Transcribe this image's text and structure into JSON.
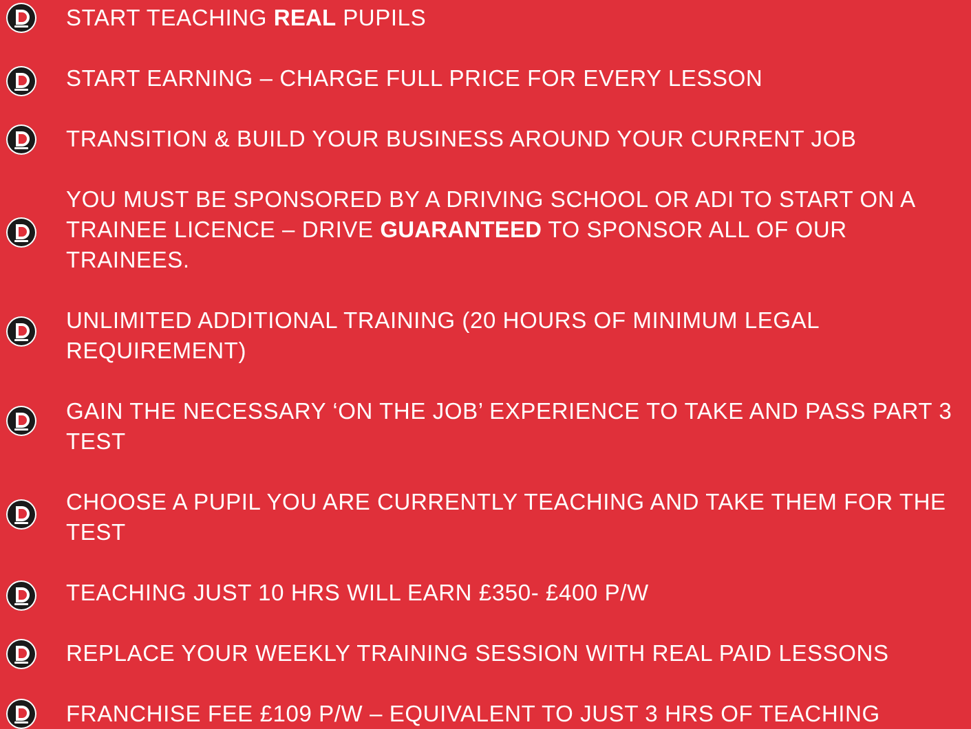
{
  "badge_text": "DRIVE",
  "colors": {
    "background": "#e0303a",
    "text": "#ffffff",
    "badge": "#1a1a1a"
  },
  "items": [
    {
      "text_before": "START TEACHING ",
      "bold": "REAL",
      "text_after": " PUPILS"
    },
    {
      "text_before": "START EARNING – CHARGE FULL PRICE FOR EVERY LESSON",
      "bold": "",
      "text_after": ""
    },
    {
      "text_before": "TRANSITION & BUILD YOUR BUSINESS AROUND YOUR CURRENT JOB",
      "bold": "",
      "text_after": ""
    },
    {
      "text_before": "YOU MUST BE SPONSORED BY A DRIVING SCHOOL OR ADI TO START ON A TRAINEE LICENCE – DRIVE ",
      "bold": "GUARANTEED",
      "text_after": " TO SPONSOR ALL OF OUR TRAINEES."
    },
    {
      "text_before": "UNLIMITED ADDITIONAL TRAINING (20 HOURS OF MINIMUM LEGAL REQUIREMENT)",
      "bold": "",
      "text_after": ""
    },
    {
      "text_before": "GAIN THE NECESSARY ‘ON THE JOB’ EXPERIENCE TO TAKE AND PASS PART 3 TEST",
      "bold": "",
      "text_after": ""
    },
    {
      "text_before": "CHOOSE A PUPIL YOU ARE CURRENTLY TEACHING AND TAKE THEM FOR THE TEST",
      "bold": "",
      "text_after": ""
    },
    {
      "text_before": "TEACHING JUST 10 HRS WILL EARN £350- £400 P/W",
      "bold": "",
      "text_after": ""
    },
    {
      "text_before": "REPLACE YOUR WEEKLY TRAINING SESSION WITH REAL PAID LESSONS",
      "bold": "",
      "text_after": ""
    },
    {
      "text_before": "FRANCHISE FEE £109 P/W – EQUIVALENT TO JUST 3 HRS OF TEACHING",
      "bold": "",
      "text_after": ""
    }
  ]
}
